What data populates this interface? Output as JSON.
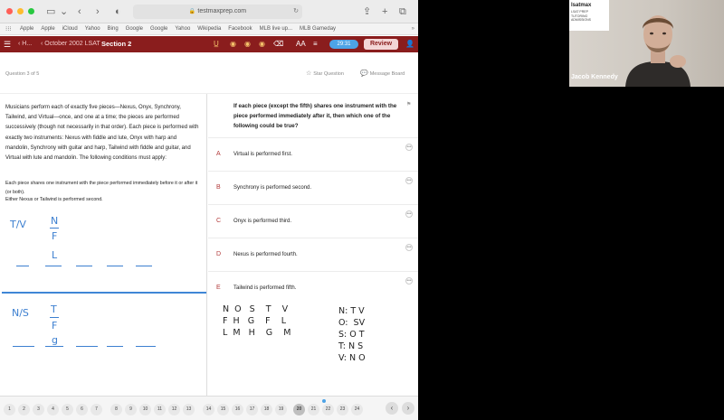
{
  "browser": {
    "url": "testmaxprep.com",
    "bookmarks": [
      "Apple",
      "Apple",
      "iCloud",
      "Yahoo",
      "Bing",
      "Google",
      "Google",
      "Yahoo",
      "Wikipedia",
      "Facebook",
      "MLB live up...",
      "MLB Gameday"
    ]
  },
  "header": {
    "back_label": "H...",
    "prep_label": "October 2002 LSAT",
    "section_label": "Section 2",
    "timer": "29:31",
    "review_label": "Review"
  },
  "qbar": {
    "count": "Question 3 of 5",
    "star_label": "Star Question",
    "message_label": "Message Board"
  },
  "passage": {
    "intro": "Musicians perform each of exactly five pieces—Nexus, Onyx, Synchrony, Tailwind, and Virtual—once, and one at a time; the pieces are performed successively (though not necessarily in that order). Each piece is performed with exactly two instruments: Nexus with fiddle and lute, Onyx with harp and mandolin, Synchrony with guitar and harp, Tailwind with fiddle and guitar, and Virtual with lute and mandolin. The following conditions must apply:",
    "rule1": "Each piece shares one instrument with the piece performed immediately before it or after it (or both).",
    "rule2": "Either Nexus or Tailwind is performed second."
  },
  "sketch": {
    "top_label": "T/V",
    "top_stack": [
      "N",
      "F",
      "L"
    ],
    "bottom_label": "N/S",
    "bottom_stack": [
      "T",
      "F",
      "g"
    ]
  },
  "question": {
    "stem": "If each piece (except the fifth) shares one instrument with the piece performed immediately after it, then which one of the following could be true?",
    "choices": [
      {
        "letter": "A",
        "text": "Virtual is performed first."
      },
      {
        "letter": "B",
        "text": "Synchrony is performed second."
      },
      {
        "letter": "C",
        "text": "Onyx is performed third."
      },
      {
        "letter": "D",
        "text": "Nexus is performed fourth."
      },
      {
        "letter": "E",
        "text": "Tailwind is performed fifth."
      }
    ]
  },
  "grid": {
    "row1": "N  O   S    T    V",
    "row2": "F  H   G    F    L",
    "row3": "L  M   H    G    M",
    "pairs": [
      "N: T V",
      "O:  SV",
      "S: O T",
      "T: N S",
      "V: N O"
    ]
  },
  "pages": [
    "1",
    "2",
    "3",
    "4",
    "5",
    "6",
    "7",
    "8",
    "9",
    "10",
    "11",
    "12",
    "13",
    "14",
    "15",
    "16",
    "17",
    "18",
    "19",
    "20",
    "21",
    "22",
    "23",
    "24"
  ],
  "active_page": "20",
  "webcam": {
    "brand": "lsatmax",
    "tagline": "LSAT PREP TUTORING ADMISSIONS",
    "name": "Jacob Kennedy"
  },
  "colors": {
    "header": "#8a1d1d",
    "timer": "#4da3e6",
    "handwriting": "#3c7fd0"
  }
}
